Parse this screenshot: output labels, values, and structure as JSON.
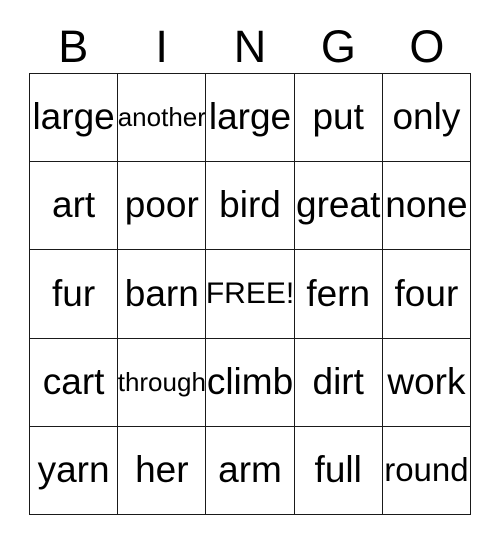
{
  "card": {
    "title": "BINGO",
    "header_letters": [
      "B",
      "I",
      "N",
      "G",
      "O"
    ],
    "free_space": "FREE!",
    "grid_line_color": "#1a1a1a",
    "background_color": "#ffffff",
    "text_color": "#000000",
    "rows": 5,
    "columns": 5,
    "cells": [
      [
        {
          "text": "large",
          "size": "size-lg"
        },
        {
          "text": "another",
          "size": "size-xs"
        },
        {
          "text": "large",
          "size": "size-lg"
        },
        {
          "text": "put",
          "size": "size-lg"
        },
        {
          "text": "only",
          "size": "size-lg"
        }
      ],
      [
        {
          "text": "art",
          "size": "size-lg"
        },
        {
          "text": "poor",
          "size": "size-lg"
        },
        {
          "text": "bird",
          "size": "size-lg"
        },
        {
          "text": "great",
          "size": "size-lg"
        },
        {
          "text": "none",
          "size": "size-lg"
        }
      ],
      [
        {
          "text": "fur",
          "size": "size-lg"
        },
        {
          "text": "barn",
          "size": "size-lg"
        },
        {
          "text": "FREE!",
          "size": "size-sm"
        },
        {
          "text": "fern",
          "size": "size-lg"
        },
        {
          "text": "four",
          "size": "size-lg"
        }
      ],
      [
        {
          "text": "cart",
          "size": "size-lg"
        },
        {
          "text": "through",
          "size": "size-xs"
        },
        {
          "text": "climb",
          "size": "size-lg"
        },
        {
          "text": "dirt",
          "size": "size-lg"
        },
        {
          "text": "work",
          "size": "size-lg"
        }
      ],
      [
        {
          "text": "yarn",
          "size": "size-lg"
        },
        {
          "text": "her",
          "size": "size-lg"
        },
        {
          "text": "arm",
          "size": "size-lg"
        },
        {
          "text": "full",
          "size": "size-lg"
        },
        {
          "text": "round",
          "size": "size-md"
        }
      ]
    ]
  }
}
